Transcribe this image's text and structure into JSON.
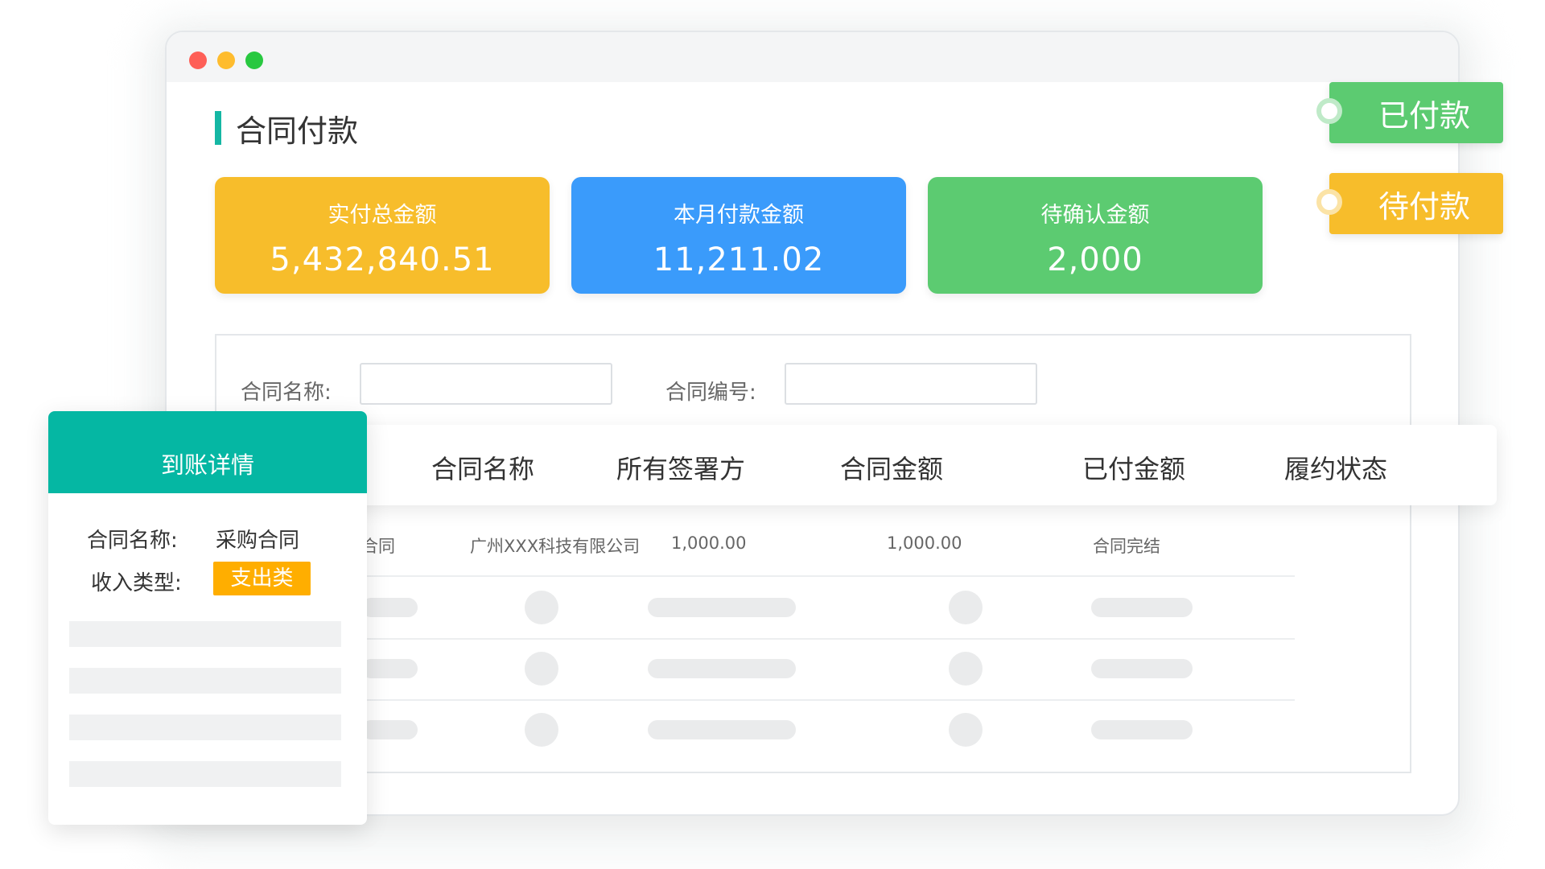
{
  "page": {
    "title": "合同付款"
  },
  "stats": [
    {
      "label": "实付总金额",
      "value": "5,432,840.51",
      "color": "#f7bd2b"
    },
    {
      "label": "本月付款金额",
      "value": "11,211.02",
      "color": "#3a9bfb"
    },
    {
      "label": "待确认金额",
      "value": "2,000",
      "color": "#5ccb71"
    }
  ],
  "filters": {
    "contract_name_label": "合同名称:",
    "contract_name_value": "",
    "contract_no_label": "合同编号:",
    "contract_no_value": ""
  },
  "table": {
    "columns": [
      "合同名称",
      "所有签署方",
      "合同金额",
      "已付金额",
      "履约状态"
    ],
    "rows": [
      {
        "name": "合同",
        "party": "广州XXX科技有限公司",
        "amount": "1,000.00",
        "paid": "1,000.00",
        "status": "合同完结"
      }
    ]
  },
  "status_tags": {
    "paid": "已付款",
    "pending": "待付款"
  },
  "detail": {
    "title": "到账详情",
    "name_label": "合同名称:",
    "name_value": "采购合同",
    "type_label": "收入类型:",
    "type_value": "支出类"
  },
  "colors": {
    "accent_teal": "#05b7a3",
    "orange": "#f7bd2b",
    "blue": "#3a9bfb",
    "green": "#5ccb71",
    "expense_badge": "#ffae00"
  }
}
